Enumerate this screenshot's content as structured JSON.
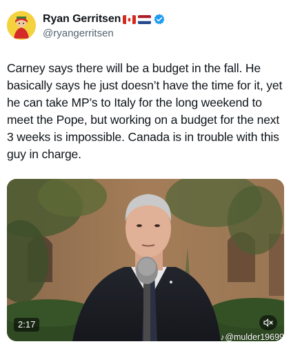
{
  "user": {
    "display_name": "Ryan Gerritsen",
    "handle": "@ryangerritsen",
    "flags": [
      "canada-flag",
      "netherlands-flag"
    ],
    "verified": true
  },
  "tweet": {
    "text": "Carney says there will be a budget in the fall. He basically says he just doesn’t have the time for it, yet he can take MP’s to Italy for the long weekend to meet the Pope, but working on a budget for the next 3 weeks is impossible. Canada is in trouble with this guy in charge."
  },
  "video": {
    "duration": "2:17",
    "watermark": "@mulder19699",
    "mute_icon": "muted-speaker-icon",
    "tiktok_icon": "tiktok-note-icon"
  },
  "colors": {
    "text": "#0f1419",
    "secondary": "#536471",
    "verified": "#1d9bf0"
  }
}
